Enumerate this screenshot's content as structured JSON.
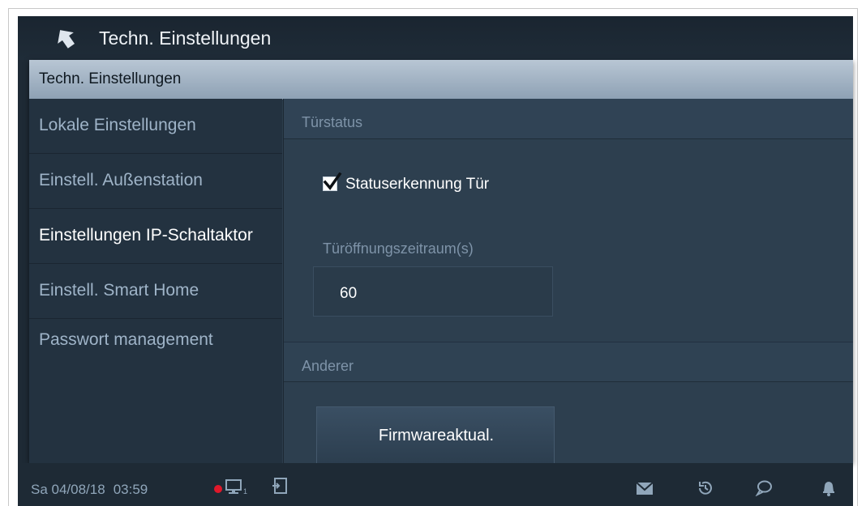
{
  "titlebar": {
    "title": "Techn. Einstellungen"
  },
  "panel": {
    "header": "Techn. Einstellungen"
  },
  "sidebar": {
    "items": [
      {
        "label": "Lokale Einstellungen",
        "active": false
      },
      {
        "label": "Einstell. Außenstation",
        "active": false
      },
      {
        "label": "Einstellungen IP-Schaltaktor",
        "active": true
      },
      {
        "label": "Einstell. Smart Home",
        "active": false
      },
      {
        "label": "Passwort management",
        "active": false
      }
    ]
  },
  "content": {
    "door_status": {
      "header": "Türstatus",
      "checkbox_label": "Statuserkennung Tür",
      "checkbox_checked": true,
      "field_label": "Türöffnungszeitraum(s)",
      "field_value": "60"
    },
    "other": {
      "header": "Anderer",
      "firmware_button": "Firmwareaktual."
    }
  },
  "statusbar": {
    "date": "Sa 04/08/18",
    "time": "03:59",
    "network_count": "1"
  },
  "colors": {
    "accent_red": "#e0182a",
    "background": "#1e2a35",
    "panel_header": "#a5b5c5"
  },
  "icons": {
    "back": "back-arrow-icon",
    "status": [
      "record-dot-icon",
      "network-monitor-icon",
      "door-exit-icon"
    ],
    "right": [
      "mail-icon",
      "history-icon",
      "chat-icon",
      "bell-icon"
    ]
  }
}
